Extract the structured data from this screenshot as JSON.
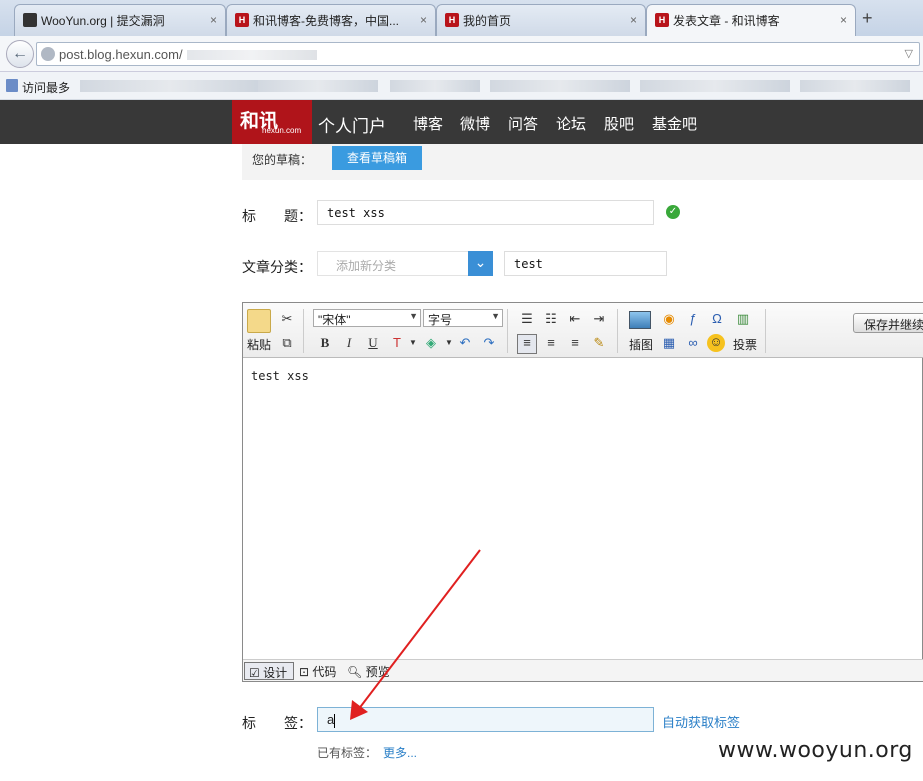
{
  "browser": {
    "tabs": [
      {
        "title": "WooYun.org | 提交漏洞",
        "close": "×"
      },
      {
        "title": "和讯博客-免费博客，中国...",
        "close": "×"
      },
      {
        "title": "我的首页",
        "close": "×"
      },
      {
        "title": "发表文章 - 和讯博客",
        "close": "×"
      }
    ],
    "new_tab": "+",
    "url": "post.blog.hexun.com/",
    "bookmarks_label": "访问最多"
  },
  "site": {
    "logo_cn": "和讯",
    "logo_en": "hexun.com",
    "portal": "个人门户",
    "nav": [
      "博客",
      "微博",
      "问答",
      "论坛",
      "股吧",
      "基金吧"
    ]
  },
  "draft": {
    "label": "您的草稿：",
    "button": "查看草稿箱"
  },
  "form": {
    "title_label": "标　　题：",
    "title_value": "test xss",
    "category_label": "文章分类：",
    "category_placeholder": "添加新分类",
    "category_value": "test",
    "tag_label": "标　　签：",
    "tag_value": "a",
    "auto_tag": "自动获取标签",
    "existing_tags": "已有标签：",
    "more": "更多..."
  },
  "editor": {
    "paste": "粘贴",
    "font": "\"宋体\"",
    "size": "字号",
    "insert_image": "插图",
    "vote": "投票",
    "save": "保存并继续",
    "content": "test xss",
    "modes": [
      "设计",
      "代码",
      "预览"
    ]
  },
  "watermark": "www.wooyun.org",
  "colors": {
    "brand_red": "#b0141a",
    "accent_blue": "#3a9be0",
    "site_bar": "#383838",
    "arrow": "#e02020"
  }
}
